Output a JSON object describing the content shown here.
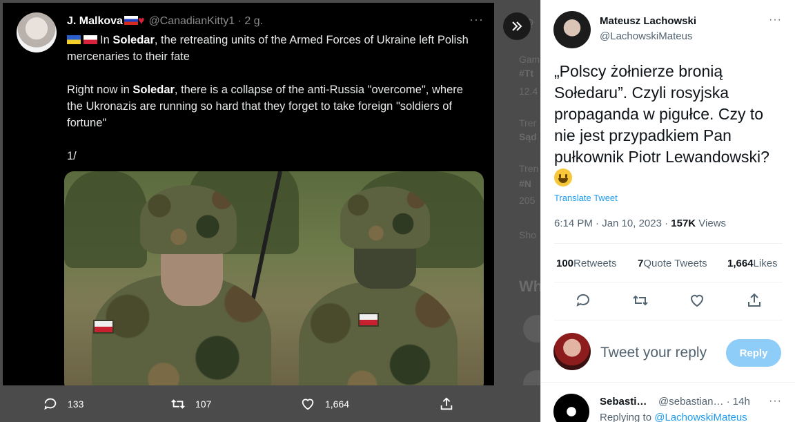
{
  "backdrop": {
    "ghost_texts": [
      "Q",
      "Gam",
      "#Tt",
      "12.4",
      "Trer",
      "Sąd",
      "Tren",
      "#N",
      "205",
      "Sho",
      "Wh"
    ]
  },
  "media": {
    "quoted_tweet": {
      "name": "J. Malkova",
      "handle_time": "@CanadianKitty1 · 2 g.",
      "more": "···",
      "para1_pre": "In ",
      "para1_bold": "Soledar",
      "para1_post": ", the retreating units of the Armed Forces of Ukraine left Polish mercenaries to their fate",
      "para2_pre": "Right now in ",
      "para2_bold": "Soledar",
      "para2_post": ", there is a collapse of the anti-Russia \"overcome\", where the Ukronazis are running so hard that they forget to take foreign \"soldiers of fortune\"",
      "para3": "1/"
    }
  },
  "action_bar": {
    "replies": "133",
    "retweets": "107",
    "likes": "1,664"
  },
  "panel": {
    "author_name": "Mateusz Lachowski",
    "author_handle": "@LachowskiMateus",
    "more": "···",
    "tweet_text": "„Polscy żołnierze bronią Sołedaru”. Czyli rosyjska propaganda w pigułce. Czy to nie jest przypadkiem Pan pułkownik Piotr Lewandowski?",
    "translate_label": "Translate Tweet",
    "timestamp": "6:14 PM · Jan 10, 2023 · ",
    "views_count": "157K",
    "views_label": " Views",
    "retweets_count": "100",
    "retweets_label": " Retweets",
    "quotes_count": "7",
    "quotes_label": " Quote Tweets",
    "likes_count": "1,664",
    "likes_label": " Likes",
    "reply_placeholder": "Tweet your reply",
    "reply_button": "Reply",
    "next_reply": {
      "name": "Sebasti…",
      "handle_time": "@sebastian… · 14h",
      "more": "···",
      "replying_to_label": "Replying to ",
      "replying_to_handle": "@LachowskiMateus"
    }
  },
  "colors": {
    "accent": "#1d9bf0",
    "reply_button_disabled": "#8ecdf8",
    "backdrop": "#4b4b4b"
  },
  "icons": [
    "chevron-double-right-icon",
    "reply-icon",
    "retweet-icon",
    "like-icon",
    "share-icon",
    "more-icon"
  ]
}
